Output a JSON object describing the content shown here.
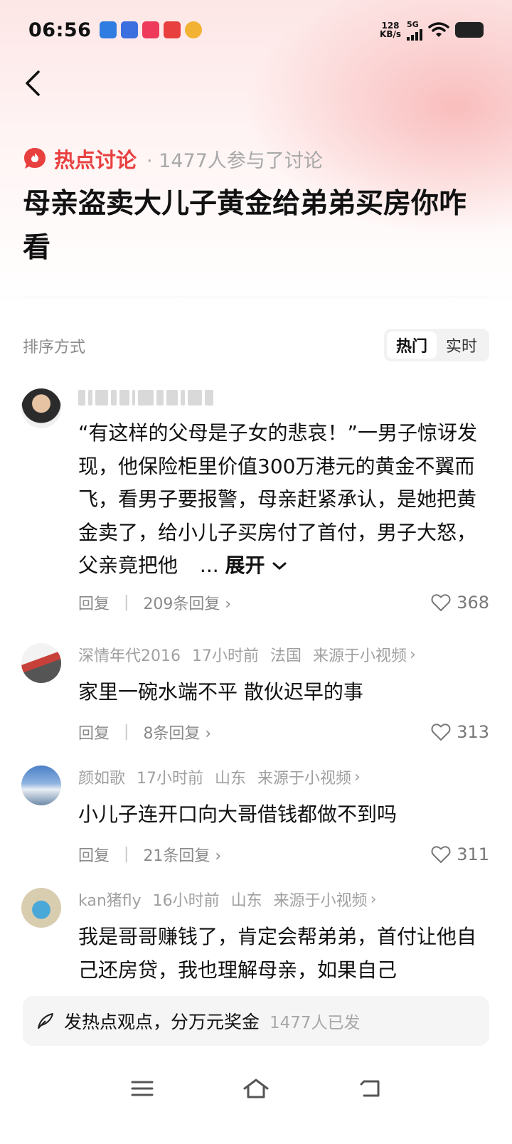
{
  "status": {
    "time": "06:56",
    "netspeed_value": "128",
    "netspeed_unit": "KB/s",
    "network": "5G"
  },
  "header": {
    "hot_label": "热点讨论",
    "participants": "· 1477人参与了讨论",
    "title": "母亲盗卖大儿子黄金给弟弟买房你咋看"
  },
  "sort": {
    "label": "排序方式",
    "options": [
      "热门",
      "实时"
    ],
    "active": "热门"
  },
  "comments": [
    {
      "user": "",
      "text": "“有这样的父母是子女的悲哀！”一男子惊讶发现，他保险柜里价值300万港元的黄金不翼而飞，看男子要报警，母亲赶紧承认，是她把黄金卖了，给小儿子买房付了首付，男子大怒，父亲竟把他",
      "ellipsis": "...",
      "expand": "展开",
      "reply": "回复",
      "replies": "209条回复",
      "likes": "368"
    },
    {
      "user": "深情年代2016",
      "time": "17小时前",
      "location": "法国",
      "source": "来源于小视频",
      "text": "家里一碗水端不平 散伙迟早的事",
      "reply": "回复",
      "replies": "8条回复",
      "likes": "313"
    },
    {
      "user": "颜如歌",
      "time": "17小时前",
      "location": "山东",
      "source": "来源于小视频",
      "text": "小儿子连开口向大哥借钱都做不到吗",
      "reply": "回复",
      "replies": "21条回复",
      "likes": "311"
    },
    {
      "user": "kan猪fly",
      "time": "16小时前",
      "location": "山东",
      "source": "来源于小视频",
      "text": "我是哥哥赚钱了，肯定会帮弟弟，首付让他自己还房贷，我也理解母亲，如果自己"
    }
  ],
  "post_bar": {
    "text": "发热点观点，分万元奖金",
    "count": "1477人已发"
  },
  "colors": {
    "accent": "#e8403f",
    "muted": "#a0a0a0"
  }
}
